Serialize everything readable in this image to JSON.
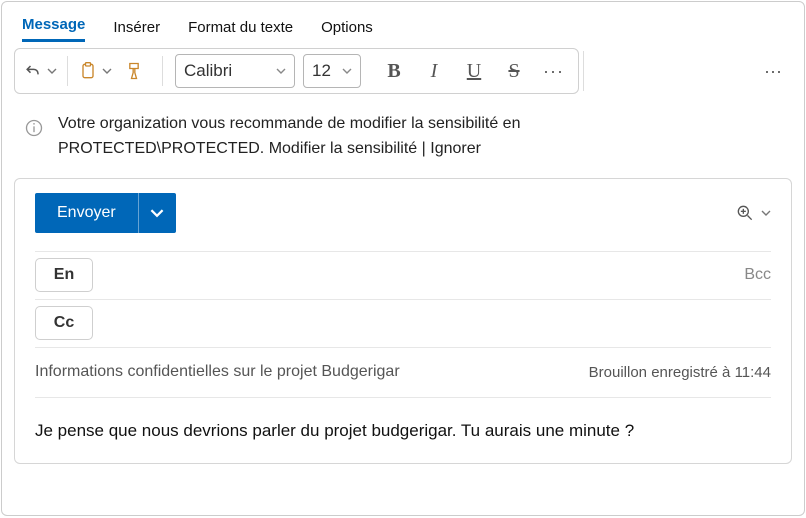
{
  "tabs": {
    "message": "Message",
    "insert": "Insérer",
    "format": "Format du texte",
    "options": "Options"
  },
  "toolbar": {
    "font_name": "Calibri",
    "font_size": "12"
  },
  "info": {
    "line1": "Votre organization vous recommande de modifier la sensibilité en",
    "line2_prefix": "PROTECTED\\PROTECTED. ",
    "modify": "Modifier la sensibilité",
    "sep": " | ",
    "ignore": "Ignorer"
  },
  "compose": {
    "send": "Envoyer",
    "to_label": "En",
    "cc_label": "Cc",
    "bcc_label": "Bcc",
    "subject": "Informations confidentielles sur le projet Budgerigar",
    "draft_saved": "Brouillon enregistré à 11:44",
    "body": "Je pense que nous devrions parler du projet budgerigar. Tu aurais une minute ?"
  }
}
